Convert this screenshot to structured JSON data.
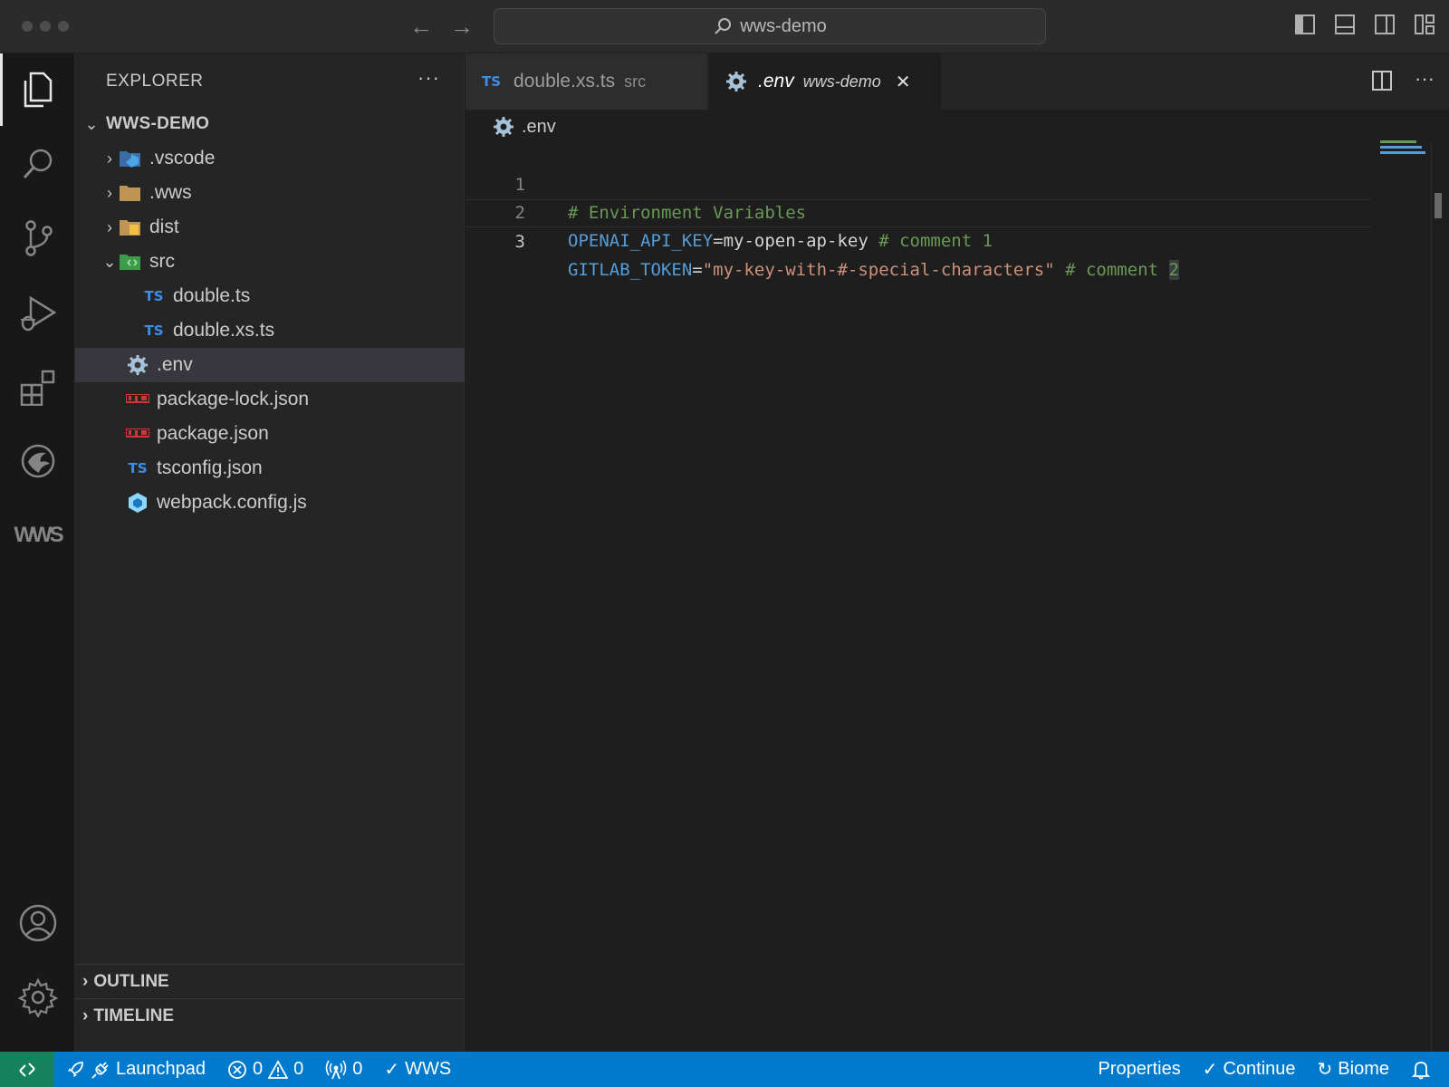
{
  "titlebar": {
    "search_text": "wws-demo",
    "back_icon": "arrow-left-icon",
    "forward_icon": "arrow-right-icon"
  },
  "activity": {
    "items": [
      "explorer-icon",
      "search-icon",
      "source-control-icon",
      "run-debug-icon",
      "extensions-icon",
      "phoenix-icon",
      "wws-icon",
      "account-icon",
      "settings-gear-icon"
    ],
    "wws_label": "WS"
  },
  "sidebar": {
    "title": "EXPLORER",
    "more": "···",
    "root": "WWS-DEMO",
    "tree": [
      {
        "label": ".vscode"
      },
      {
        "label": ".wws"
      },
      {
        "label": "dist"
      },
      {
        "label": "src"
      },
      {
        "label": "double.ts",
        "icon_text": "TS"
      },
      {
        "label": "double.xs.ts",
        "icon_text": "TS"
      },
      {
        "label": ".env"
      },
      {
        "label": "package-lock.json"
      },
      {
        "label": "package.json"
      },
      {
        "label": "tsconfig.json",
        "icon_text": "TS"
      },
      {
        "label": "webpack.config.js"
      }
    ],
    "panels": {
      "outline": "OUTLINE",
      "timeline": "TIMELINE"
    }
  },
  "editor": {
    "tabs": [
      {
        "icon_text": "TS",
        "title": "double.xs.ts",
        "desc": "src"
      },
      {
        "title": ".env",
        "desc": "wws-demo",
        "close": "✕"
      }
    ],
    "breadcrumb": ".env",
    "lines": [
      {
        "num": "1",
        "comment": "# Environment Variables"
      },
      {
        "num": "2",
        "key": "OPENAI_API_KEY",
        "eq": "=",
        "value": "my-open-ap-key",
        "comment": " # comment 1"
      },
      {
        "num": "3",
        "key": "GITLAB_TOKEN",
        "eq": "=",
        "value": "\"my-key-with-#-special-characters\"",
        "comment": " # comment ",
        "cursor_char": "2"
      }
    ]
  },
  "statusbar": {
    "launchpad": "Launchpad",
    "errors": "0",
    "warnings": "0",
    "ports": "0",
    "wws": "WWS",
    "properties": "Properties",
    "continue": "Continue",
    "biome": "Biome"
  },
  "colors": {
    "accent": "#007acc",
    "remote": "#16825d",
    "ts_blue": "#3b8eea",
    "comment_green": "#6a9955",
    "key_blue": "#569cd6",
    "string_orange": "#ce9178"
  }
}
